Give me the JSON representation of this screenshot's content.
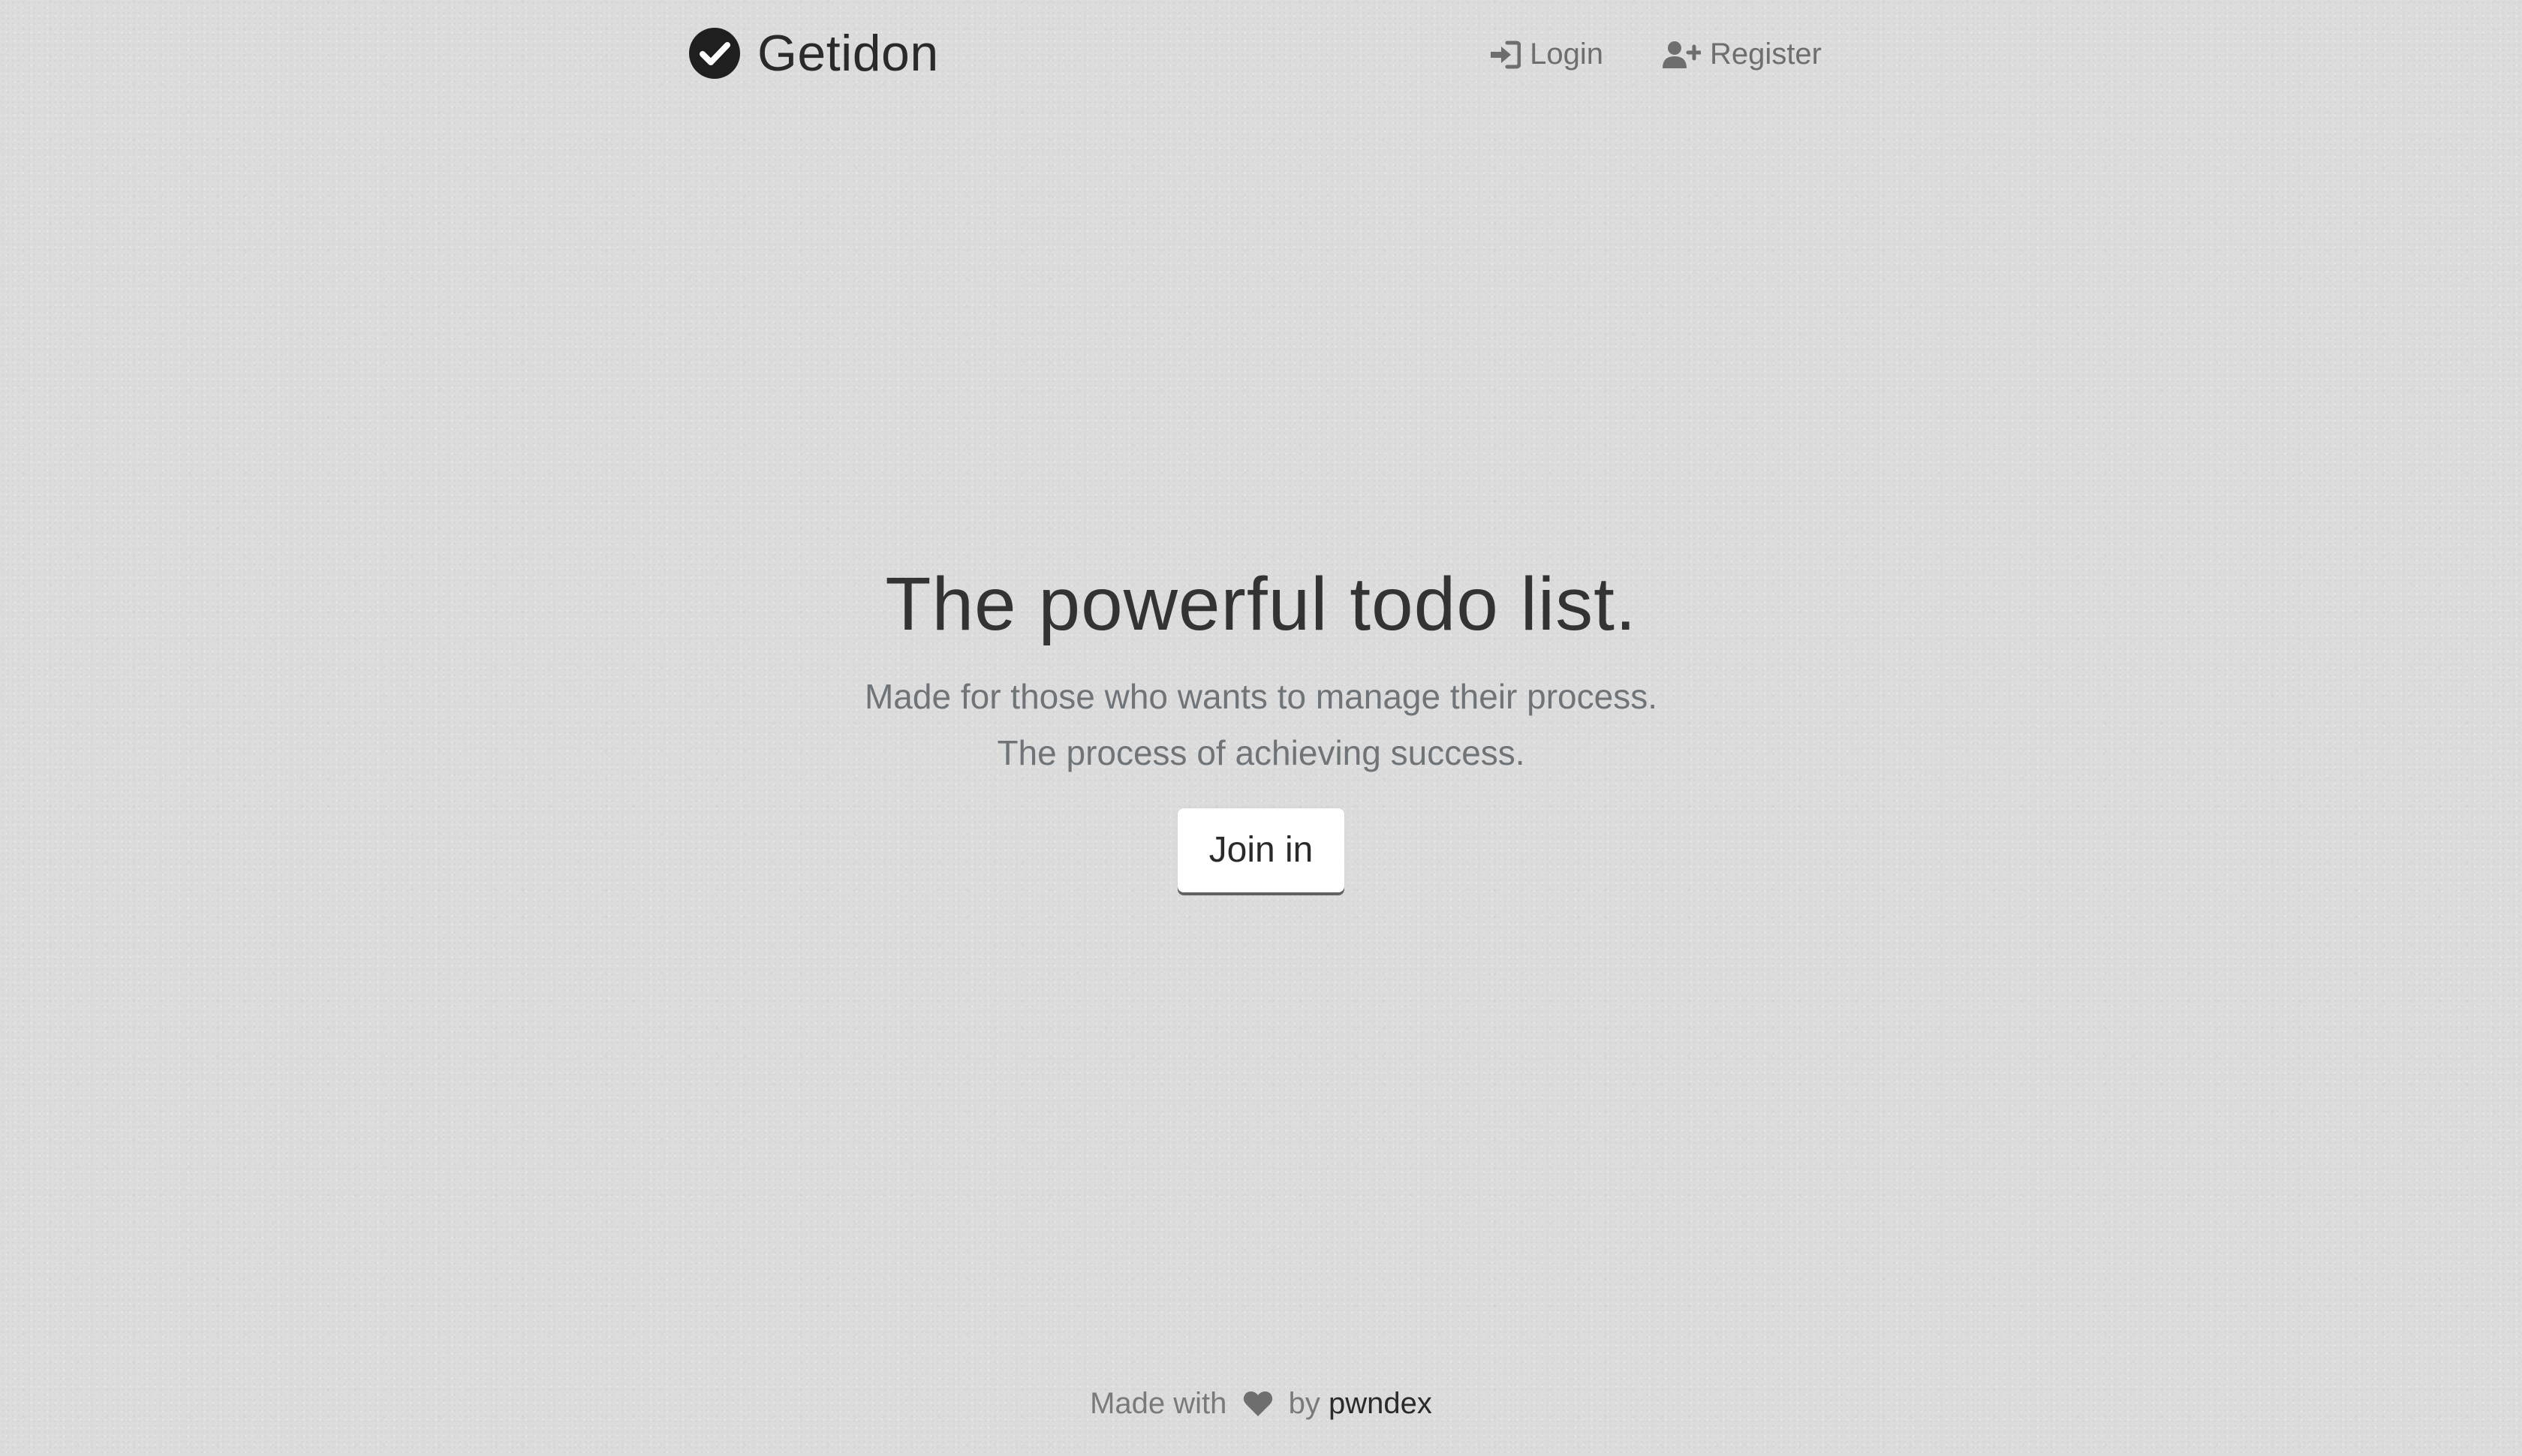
{
  "navbar": {
    "brand_name": "Getidon",
    "brand_icon": "check-circle-icon",
    "links": [
      {
        "label": "Login",
        "icon": "sign-in-icon"
      },
      {
        "label": "Register",
        "icon": "user-plus-icon"
      }
    ]
  },
  "hero": {
    "title": "The powerful todo list.",
    "subtitle_line1": "Made for those who wants to manage their process.",
    "subtitle_line2": "The process of achieving success.",
    "cta_label": "Join in"
  },
  "footer": {
    "made_with": "Made with",
    "heart_icon": "heart-icon",
    "by": "by",
    "author": "pwndex"
  },
  "colors": {
    "background": "#dcdcdc",
    "text_dark": "#2a2a2a",
    "text_muted": "#6f7479",
    "button_bg": "#ffffff"
  }
}
